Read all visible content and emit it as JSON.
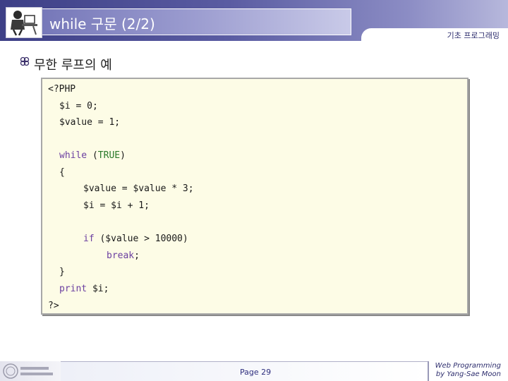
{
  "header": {
    "title": "while 구문 (2/2)",
    "course": "기초 프로그래밍"
  },
  "content": {
    "bullet": "무한 루프의 예"
  },
  "code": [
    {
      "parts": [
        {
          "t": "<?PHP",
          "c": "plain"
        }
      ]
    },
    {
      "parts": [
        {
          "t": "$i = 0;",
          "c": "plain"
        }
      ]
    },
    {
      "parts": [
        {
          "t": "$value = 1;",
          "c": "plain"
        }
      ]
    },
    {
      "parts": [
        {
          "t": "while",
          "c": "keyword"
        },
        {
          "t": " (",
          "c": "plain"
        },
        {
          "t": "TRUE",
          "c": "constant"
        },
        {
          "t": ")",
          "c": "plain"
        }
      ]
    },
    {
      "parts": [
        {
          "t": "{",
          "c": "plain"
        }
      ]
    },
    {
      "parts": [
        {
          "t": "$value = $value * 3;",
          "c": "plain"
        }
      ]
    },
    {
      "parts": [
        {
          "t": "$i = $i + 1;",
          "c": "plain"
        }
      ]
    },
    {
      "parts": [
        {
          "t": "if",
          "c": "keyword"
        },
        {
          "t": " ($value > 10000)",
          "c": "plain"
        }
      ]
    },
    {
      "parts": [
        {
          "t": "break",
          "c": "keyword"
        },
        {
          "t": ";",
          "c": "plain"
        }
      ]
    },
    {
      "parts": [
        {
          "t": "}",
          "c": "plain"
        }
      ]
    },
    {
      "parts": [
        {
          "t": "print",
          "c": "keyword"
        },
        {
          "t": " $i;",
          "c": "plain"
        }
      ]
    },
    {
      "parts": [
        {
          "t": "?>",
          "c": "plain"
        }
      ]
    }
  ],
  "footer": {
    "page": "Page 29",
    "credit_line1": "Web Programming",
    "credit_line2": "by Yang-Sae Moon"
  },
  "icons": {
    "logo": "person-at-desk-icon",
    "bullet": "flower-bullet-icon",
    "seal": "university-seal-icon"
  },
  "colors": {
    "header": "#3d3f86",
    "code_background": "#fdfce6",
    "keyword": "#6b3fa0",
    "constant": "#2a7a2a"
  }
}
